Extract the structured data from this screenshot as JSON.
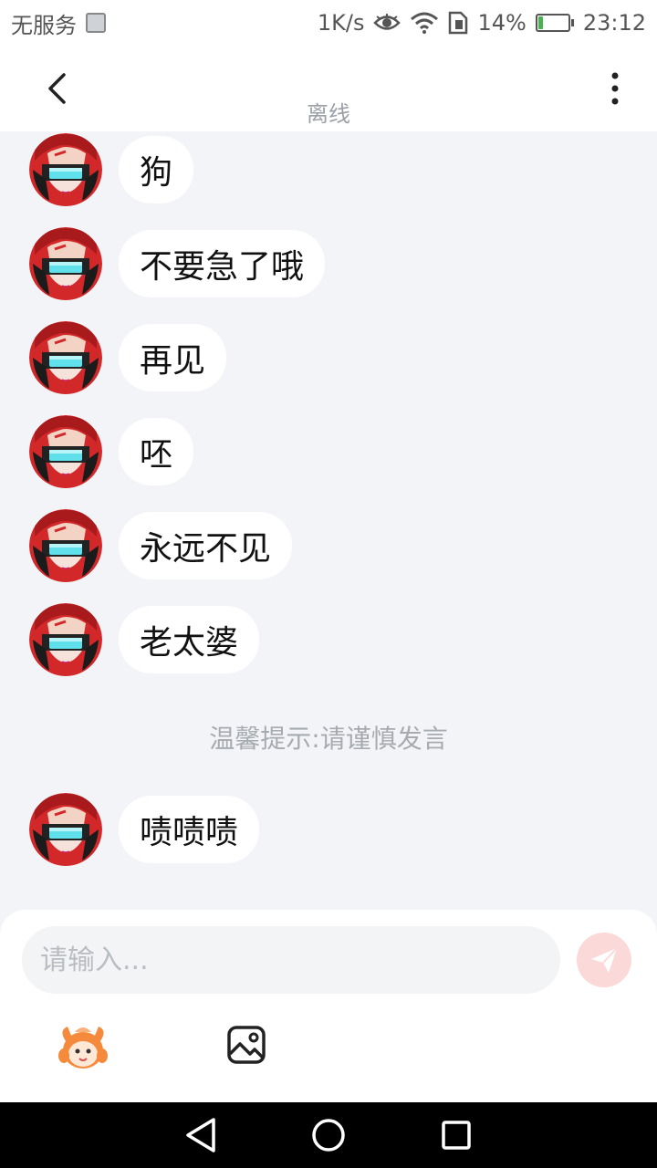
{
  "status_bar": {
    "carrier": "无服务",
    "speed": "1K/s",
    "battery_percent": "14%",
    "battery_level": 0.14,
    "time": "23:12"
  },
  "header": {
    "presence": "离线"
  },
  "messages": [
    {
      "text": "狗"
    },
    {
      "text": "不要急了哦"
    },
    {
      "text": "再见"
    },
    {
      "text": "呸"
    },
    {
      "text": "永远不见"
    },
    {
      "text": "老太婆"
    },
    {
      "text": "啧啧啧"
    }
  ],
  "notice": "温馨提示:请谨慎发言",
  "composer": {
    "placeholder": "请输入..."
  },
  "colors": {
    "background": "#f3f4f7",
    "send_button": "#fbd9d8",
    "avatar_red": "#d3282a",
    "visor_cyan": "#5fe0ea"
  },
  "icons": {
    "back": "chevron-left-icon",
    "more": "more-vertical-icon",
    "send": "paper-plane-icon",
    "emoji": "mascot-emoji-icon",
    "image": "image-icon"
  }
}
